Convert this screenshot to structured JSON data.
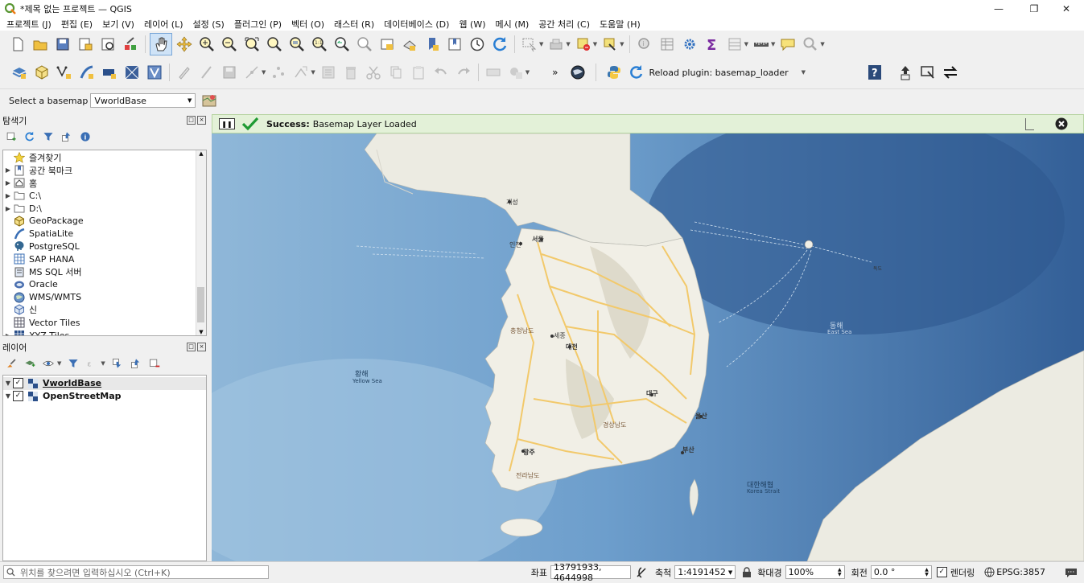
{
  "window": {
    "title": "*제목 없는 프로젝트 — QGIS"
  },
  "menu": [
    "프로젝트 (J)",
    "편집 (E)",
    "보기 (V)",
    "레이어 (L)",
    "설정 (S)",
    "플러그인 (P)",
    "벡터 (O)",
    "래스터 (R)",
    "데이터베이스 (D)",
    "웹 (W)",
    "메시 (M)",
    "공간 처리 (C)",
    "도움말 (H)"
  ],
  "toolbar2": {
    "overflow": "»",
    "reload_plugin_label": "Reload plugin: basemap_loader"
  },
  "basemap": {
    "label": "Select a basemap",
    "selected": "VworldBase"
  },
  "message": {
    "title": "Success:",
    "text": "Basemap Layer Loaded"
  },
  "browser": {
    "title": "탐색기",
    "items": [
      {
        "label": "즐겨찾기",
        "icon": "star-icon",
        "expandable": false
      },
      {
        "label": "공간 북마크",
        "icon": "bookmark-icon",
        "expandable": true
      },
      {
        "label": "홈",
        "icon": "home-folder-icon",
        "expandable": true
      },
      {
        "label": "C:\\",
        "icon": "folder-icon",
        "expandable": true
      },
      {
        "label": "D:\\",
        "icon": "folder-icon",
        "expandable": true
      },
      {
        "label": "GeoPackage",
        "icon": "geopackage-icon",
        "expandable": false
      },
      {
        "label": "SpatiaLite",
        "icon": "spatialite-icon",
        "expandable": false
      },
      {
        "label": "PostgreSQL",
        "icon": "postgresql-icon",
        "expandable": false
      },
      {
        "label": "SAP HANA",
        "icon": "sap-hana-icon",
        "expandable": false
      },
      {
        "label": "MS SQL 서버",
        "icon": "mssql-icon",
        "expandable": false
      },
      {
        "label": "Oracle",
        "icon": "oracle-icon",
        "expandable": false
      },
      {
        "label": "WMS/WMTS",
        "icon": "wms-icon",
        "expandable": false
      },
      {
        "label": "신",
        "icon": "wcs-icon",
        "expandable": false
      },
      {
        "label": "Vector Tiles",
        "icon": "vector-tiles-icon",
        "expandable": false
      },
      {
        "label": "XYZ Tiles",
        "icon": "xyz-tiles-icon",
        "expandable": true
      }
    ]
  },
  "layers": {
    "title": "레이어",
    "items": [
      {
        "label": "VworldBase",
        "checked": true
      },
      {
        "label": "OpenStreetMap",
        "checked": true
      }
    ]
  },
  "map_labels": [
    {
      "text": "황해"
    },
    {
      "text": "Yellow Sea"
    },
    {
      "text": "동해"
    },
    {
      "text": "East Sea"
    },
    {
      "text": "대한해협"
    },
    {
      "text": "Korea Strait"
    },
    {
      "text": "서울"
    },
    {
      "text": "인천"
    },
    {
      "text": "개성"
    },
    {
      "text": "세종"
    },
    {
      "text": "대전"
    },
    {
      "text": "대구"
    },
    {
      "text": "울산"
    },
    {
      "text": "부산"
    },
    {
      "text": "광주"
    },
    {
      "text": "전라남도"
    },
    {
      "text": "경상남도"
    },
    {
      "text": "충청남도"
    },
    {
      "text": "독도"
    }
  ],
  "statusbar": {
    "search_placeholder": "위치를 찾으려면 입력하십시오 (Ctrl+K)",
    "coord_label": "좌표",
    "coord_value": "13791933, 4644998",
    "scale_label": "축척",
    "scale_value": "1:4191452",
    "magnifier_label": "확대경",
    "magnifier_value": "100%",
    "rotation_label": "회전",
    "rotation_value": "0.0 °",
    "render_label": "렌더링",
    "crs": "EPSG:3857"
  },
  "colors": {
    "sea": "#4f7fb3",
    "land": "#f1efe6",
    "success_bg": "#e3f1d8",
    "road": "#f2c96b"
  }
}
